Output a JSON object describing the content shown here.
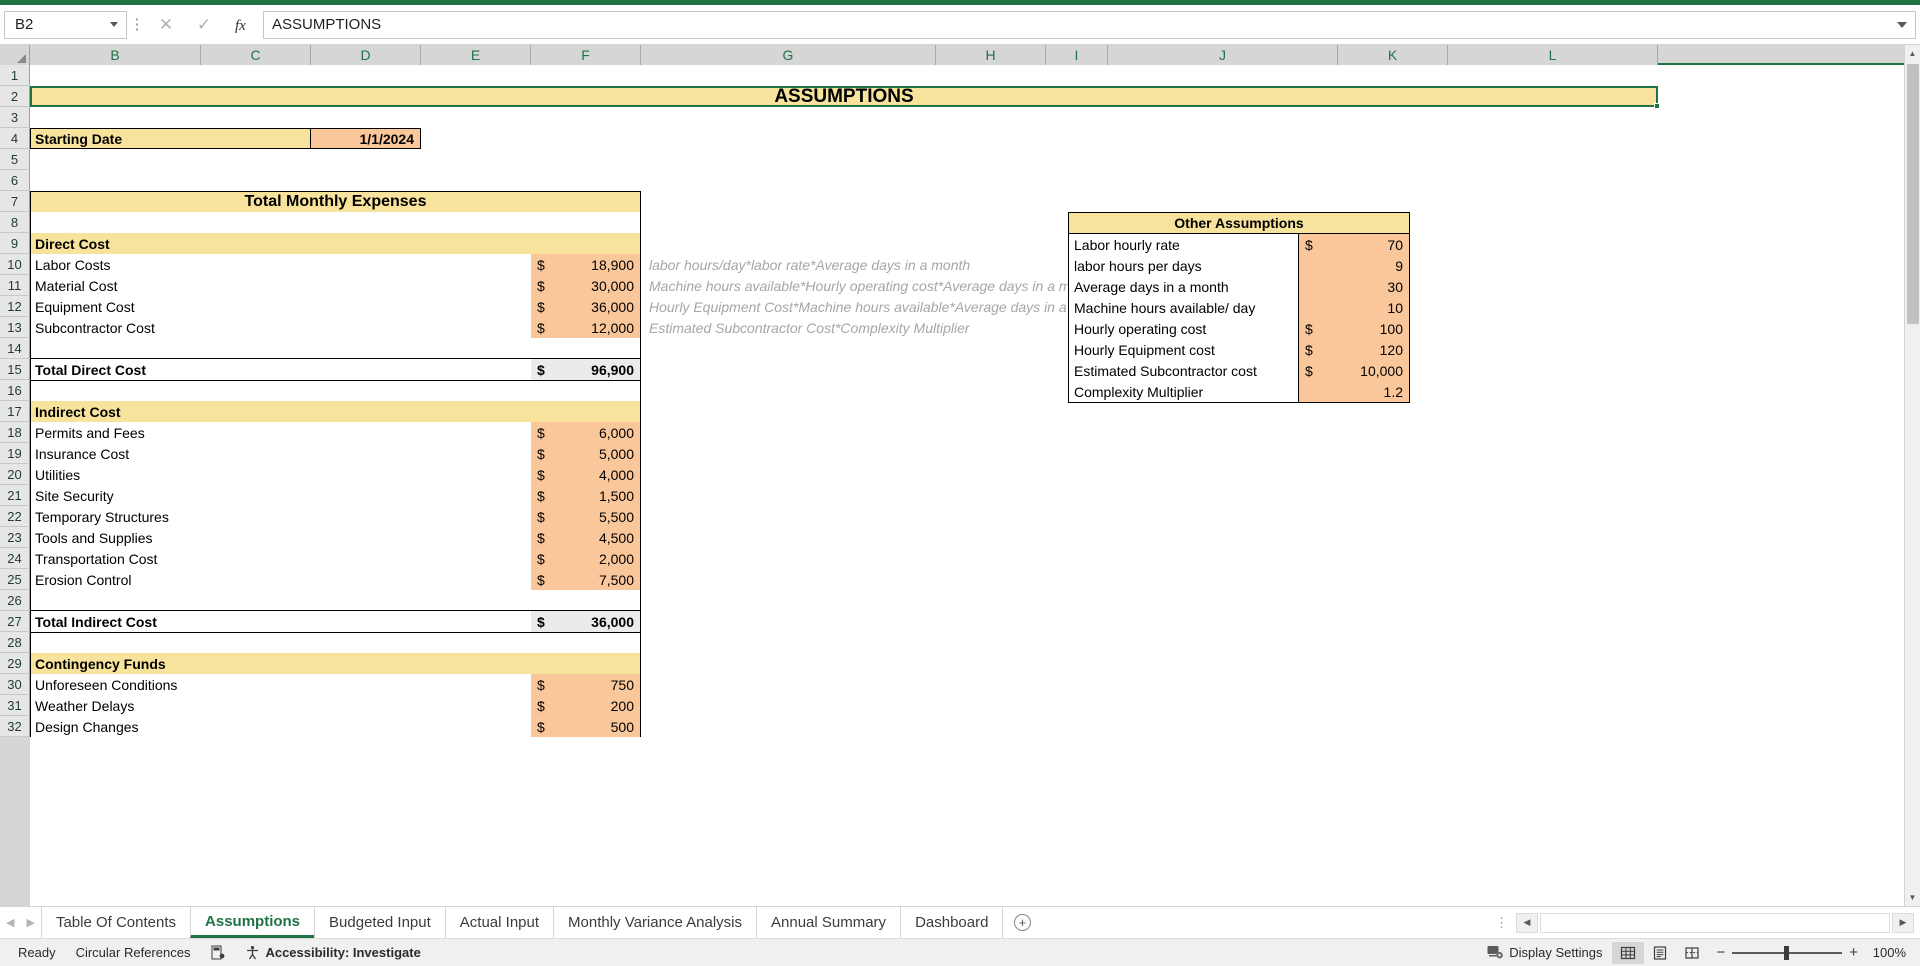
{
  "formula_bar": {
    "name_box": "B2",
    "formula_value": "ASSUMPTIONS",
    "cancel_icon": "close-icon",
    "confirm_icon": "check-icon",
    "fx_label": "fx"
  },
  "grid": {
    "column_headers": [
      "B",
      "C",
      "D",
      "E",
      "F",
      "G",
      "H",
      "I",
      "J",
      "K",
      "L"
    ],
    "row_headers": [
      "1",
      "2",
      "3",
      "4",
      "5",
      "6",
      "7",
      "8",
      "9",
      "10",
      "11",
      "12",
      "13",
      "14",
      "15",
      "16",
      "17",
      "18",
      "19",
      "20",
      "21",
      "22",
      "23",
      "24",
      "25",
      "26",
      "27",
      "28",
      "29",
      "30",
      "31",
      "32"
    ],
    "title": "ASSUMPTIONS",
    "starting_date_label": "Starting Date",
    "starting_date_value": "1/1/2024",
    "expenses_header": "Total Monthly Expenses",
    "sections": [
      {
        "header": "Direct Cost",
        "rows": [
          {
            "label": "Labor Costs",
            "symbol": "$",
            "value": "18,900",
            "note": "labor hours/day*labor rate*Average days in a month"
          },
          {
            "label": "Material Cost",
            "symbol": "$",
            "value": "30,000",
            "note": "Machine hours available*Hourly operating cost*Average days in a month"
          },
          {
            "label": "Equipment Cost",
            "symbol": "$",
            "value": "36,000",
            "note": "Hourly Equipment Cost*Machine hours available*Average days in a month"
          },
          {
            "label": "Subcontractor Cost",
            "symbol": "$",
            "value": "12,000",
            "note": "Estimated Subcontractor Cost*Complexity Multiplier"
          }
        ],
        "total_label": "Total Direct Cost",
        "total_symbol": "$",
        "total_value": "96,900"
      },
      {
        "header": "Indirect Cost",
        "rows": [
          {
            "label": "Permits and Fees",
            "symbol": "$",
            "value": "6,000",
            "note": ""
          },
          {
            "label": "Insurance Cost",
            "symbol": "$",
            "value": "5,000",
            "note": ""
          },
          {
            "label": "Utilities",
            "symbol": "$",
            "value": "4,000",
            "note": ""
          },
          {
            "label": "Site Security",
            "symbol": "$",
            "value": "1,500",
            "note": ""
          },
          {
            "label": "Temporary Structures",
            "symbol": "$",
            "value": "5,500",
            "note": ""
          },
          {
            "label": "Tools and Supplies",
            "symbol": "$",
            "value": "4,500",
            "note": ""
          },
          {
            "label": "Transportation Cost",
            "symbol": "$",
            "value": "2,000",
            "note": ""
          },
          {
            "label": "Erosion Control",
            "symbol": "$",
            "value": "7,500",
            "note": ""
          }
        ],
        "total_label": "Total Indirect Cost",
        "total_symbol": "$",
        "total_value": "36,000"
      },
      {
        "header": "Contingency Funds",
        "rows": [
          {
            "label": "Unforeseen Conditions",
            "symbol": "$",
            "value": "750",
            "note": ""
          },
          {
            "label": "Weather Delays",
            "symbol": "$",
            "value": "200",
            "note": ""
          },
          {
            "label": "Design Changes",
            "symbol": "$",
            "value": "500",
            "note": ""
          }
        ],
        "total_label": "",
        "total_symbol": "",
        "total_value": ""
      }
    ],
    "other_assumptions": {
      "header": "Other Assumptions",
      "rows": [
        {
          "label": "Labor hourly rate",
          "symbol": "$",
          "value": "70"
        },
        {
          "label": "labor hours per days",
          "symbol": "",
          "value": "9"
        },
        {
          "label": "Average days in a month",
          "symbol": "",
          "value": "30"
        },
        {
          "label": "Machine hours available/ day",
          "symbol": "",
          "value": "10"
        },
        {
          "label": "Hourly operating cost",
          "symbol": "$",
          "value": "100"
        },
        {
          "label": "Hourly Equipment cost",
          "symbol": "$",
          "value": "120"
        },
        {
          "label": "Estimated Subcontractor cost",
          "symbol": "$",
          "value": "10,000"
        },
        {
          "label": "Complexity Multiplier",
          "symbol": "",
          "value": "1.2"
        }
      ]
    }
  },
  "sheet_tabs": {
    "prev_icon": "chevron-left-icon",
    "next_icon": "chevron-right-icon",
    "add_icon": "plus-icon",
    "tabs": [
      {
        "label": "Table Of Contents",
        "active": false
      },
      {
        "label": "Assumptions",
        "active": true
      },
      {
        "label": "Budgeted Input",
        "active": false
      },
      {
        "label": "Actual Input",
        "active": false
      },
      {
        "label": "Monthly Variance Analysis",
        "active": false
      },
      {
        "label": "Annual Summary",
        "active": false
      },
      {
        "label": "Dashboard",
        "active": false
      }
    ]
  },
  "status_bar": {
    "ready": "Ready",
    "circular_references": "Circular References",
    "macro_icon": "record-macro-icon",
    "accessibility_icon": "accessibility-icon",
    "accessibility": "Accessibility: Investigate",
    "display_settings_icon": "display-settings-icon",
    "display_settings": "Display Settings",
    "view_normal_icon": "normal-view-icon",
    "view_layout_icon": "page-layout-view-icon",
    "view_break_icon": "page-break-view-icon",
    "zoom_out": "−",
    "zoom_in": "+",
    "zoom_level": "100%"
  },
  "colors": {
    "accent": "#217346",
    "header_fill": "#f8e39c",
    "input_fill": "#fac79a",
    "total_fill": "#ebebeb"
  }
}
